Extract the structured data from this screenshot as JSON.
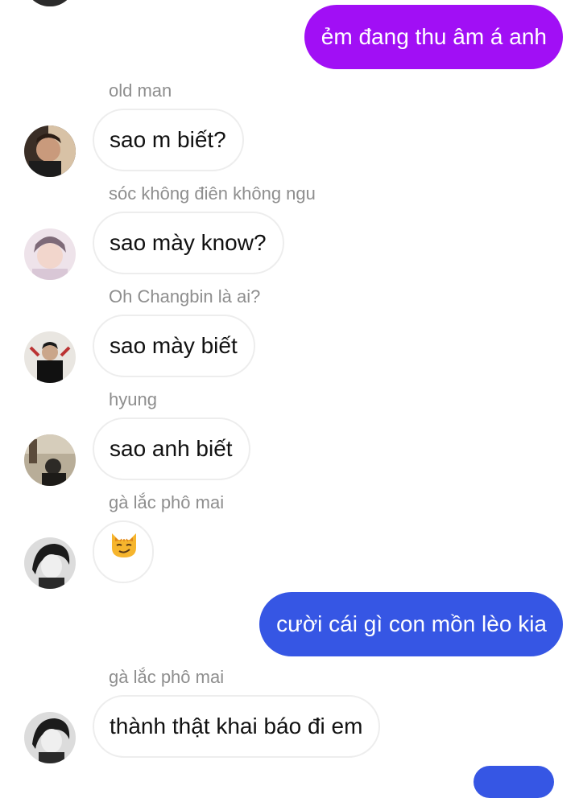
{
  "colors": {
    "outgoing_purple": "#a10ff5",
    "outgoing_blue": "#3656e4",
    "incoming_border": "#ededed",
    "sender_name": "#8e8e8e"
  },
  "messages": [
    {
      "direction": "out",
      "text": "ẻm đang thu âm á anh"
    },
    {
      "direction": "in",
      "sender": "old man",
      "text": "sao m biết?"
    },
    {
      "direction": "in",
      "sender": "sóc không điên không ngu",
      "text": "sao mày know?"
    },
    {
      "direction": "in",
      "sender": "Oh Changbin là ai?",
      "text": "sao mày biết"
    },
    {
      "direction": "in",
      "sender": "hyung",
      "text": "sao anh biết"
    },
    {
      "direction": "in",
      "sender": "gà lắc phô mai",
      "text": "",
      "emoji": "smirking-cat-emoji"
    },
    {
      "direction": "out",
      "text": "cười cái gì con mồn lèo kia"
    },
    {
      "direction": "in",
      "sender": "gà lắc phô mai",
      "text": "thành thật khai báo đi em"
    }
  ]
}
